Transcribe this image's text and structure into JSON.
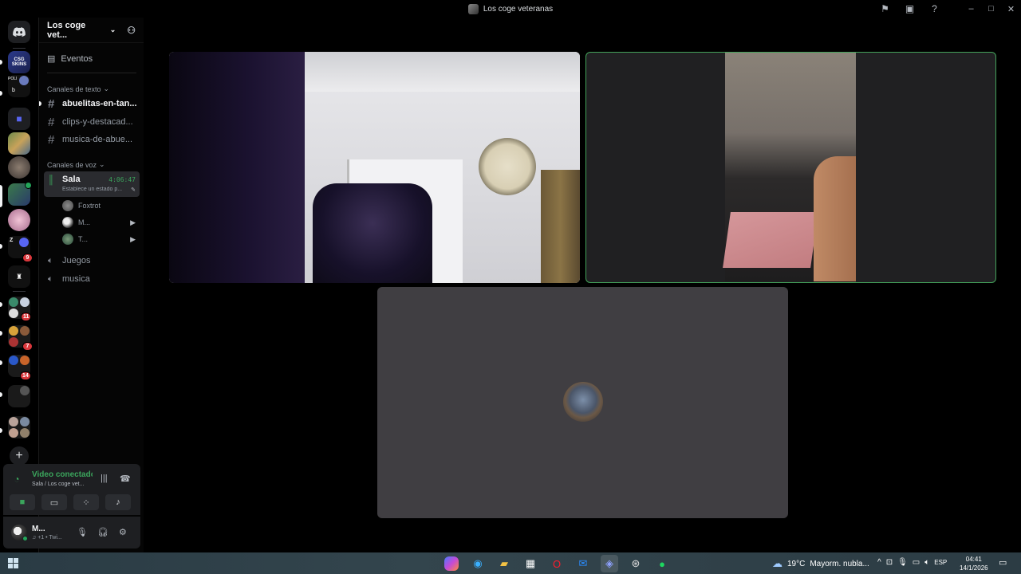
{
  "window": {
    "title": "Los coge veteranas",
    "icons": [
      "inbox-icon",
      "screen-icon",
      "help-icon"
    ],
    "controls": [
      "–",
      "□",
      "✕"
    ]
  },
  "guild": {
    "name": "Los coge vet...",
    "events_label": "Eventos",
    "text_category": "Canales de texto",
    "text_channels": [
      {
        "name": "abuelitas-en-tan...",
        "unread": true
      },
      {
        "name": "clips-y-destacad...",
        "unread": false
      },
      {
        "name": "musica-de-abue...",
        "unread": false
      }
    ],
    "voice_category": "Canales de voz",
    "active_voice": {
      "name": "Sala",
      "timer": "4:06:47",
      "status_placeholder": "Establece un estado p..."
    },
    "voice_users": [
      {
        "name": "Foxtrot",
        "camera": false
      },
      {
        "name": "M...",
        "camera": true
      },
      {
        "name": "T...",
        "camera": true
      }
    ],
    "voice_channels": [
      {
        "name": "Juegos"
      },
      {
        "name": "musica"
      }
    ]
  },
  "servers": [
    {
      "label": "CSG SKINS"
    },
    {
      "label": "b"
    },
    {
      "badge": "9"
    },
    {
      "badge": "11"
    },
    {
      "badge": "7"
    },
    {
      "badge": "14"
    }
  ],
  "rtc": {
    "status": "Video conectado",
    "channel": "Sala / Los coge vet..."
  },
  "user": {
    "name": "M...",
    "status": "♫ +1 • Twi..."
  },
  "taskbar": {
    "weather_temp": "19°C",
    "weather_text": "Mayorm. nubla...",
    "language": "ESP",
    "time": "04:41",
    "date": "14/1/2026"
  },
  "colors": {
    "accent_green": "#3ba55c",
    "badge_red": "#da373c",
    "speaking_border": "#43a25a"
  }
}
